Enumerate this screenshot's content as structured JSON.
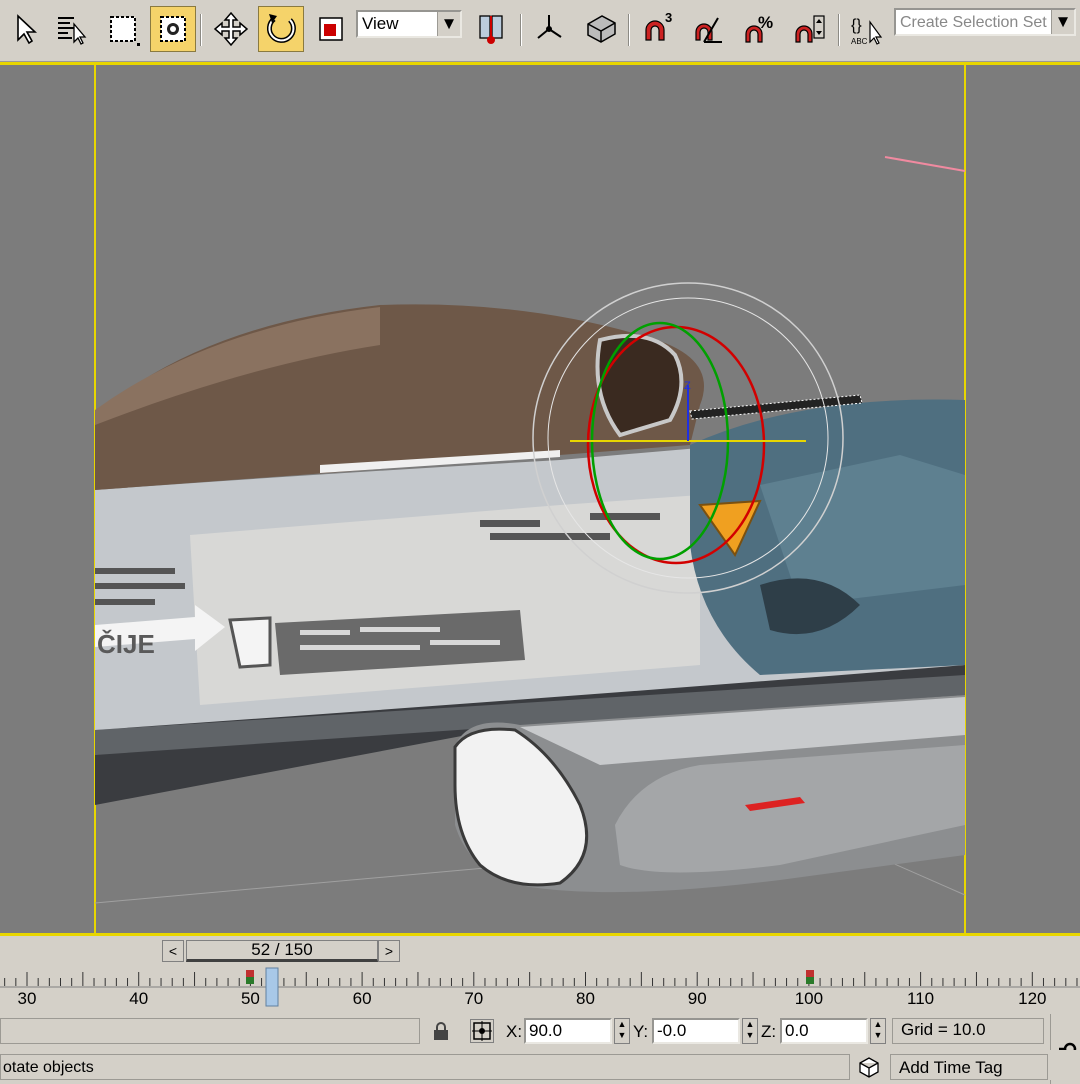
{
  "toolbar": {
    "reference_coord": "View",
    "selection_set_placeholder": "Create Selection Set"
  },
  "timeslider": {
    "label": "52 / 150",
    "prev": "<",
    "next": ">"
  },
  "ruler": {
    "ticks": [
      "30",
      "40",
      "50",
      "60",
      "70",
      "80",
      "90",
      "100",
      "110",
      "120"
    ]
  },
  "transform": {
    "x_label": "X:",
    "x_value": "90.0",
    "y_label": "Y:",
    "y_value": "-0.0",
    "z_label": "Z:",
    "z_value": "0.0",
    "grid": "Grid = 10.0"
  },
  "status": {
    "prompt": "otate objects",
    "add_time_tag": "Add Time Tag"
  },
  "viewport": {
    "decal_text": "ČIJE"
  }
}
